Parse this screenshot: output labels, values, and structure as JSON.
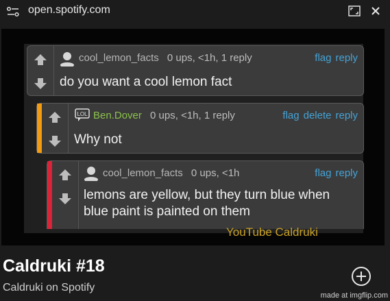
{
  "browser": {
    "url": "open.spotify.com"
  },
  "comments": [
    {
      "user": "cool_lemon_facts",
      "stats": "0 ups, <1h, 1 reply",
      "actions": [
        "flag",
        "reply"
      ],
      "text": "do you want a cool lemon fact",
      "accent": null
    },
    {
      "user": "Ben.Dover",
      "badge": "LOL",
      "stats": "0 ups, <1h, 1 reply",
      "actions": [
        "flag",
        "delete",
        "reply"
      ],
      "text": "Why not",
      "accent": "#f39c12"
    },
    {
      "user": "cool_lemon_facts",
      "stats": "0 ups, <1h",
      "actions": [
        "flag",
        "reply"
      ],
      "text_line1": "lemons are yellow, but they turn blue when",
      "text_line2": "blue paint is painted on them",
      "accent": "#d9243a"
    }
  ],
  "watermark": "YouTube Caldruki",
  "episode": {
    "title": "Caldruki #18",
    "subtitle": "Caldruki on Spotify"
  },
  "footer": {
    "credit": "made at imgflip.com"
  },
  "colors": {
    "link": "#45a3d6",
    "green_user": "#8bc34a",
    "background": "#1c1c1c"
  }
}
